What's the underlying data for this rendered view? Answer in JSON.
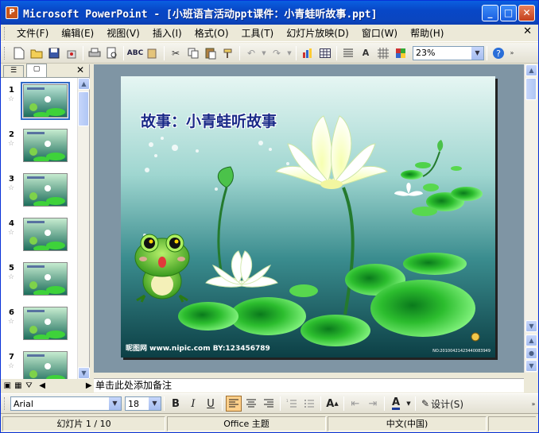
{
  "window": {
    "title": "Microsoft PowerPoint - [小班语言活动ppt课件：小青蛙听故事.ppt]"
  },
  "menu": {
    "items": [
      "文件(F)",
      "编辑(E)",
      "视图(V)",
      "插入(I)",
      "格式(O)",
      "工具(T)",
      "幻灯片放映(D)",
      "窗口(W)",
      "帮助(H)"
    ]
  },
  "toolbar": {
    "zoom": "23%"
  },
  "panel": {
    "tabs": [
      "outline-tab",
      "slides-tab"
    ]
  },
  "thumbnails": [
    {
      "num": "1",
      "selected": true,
      "bg": "#bde6d8"
    },
    {
      "num": "2",
      "selected": false,
      "bg": "#c7ecd0"
    },
    {
      "num": "3",
      "selected": false,
      "bg": "#c7ecd0"
    },
    {
      "num": "4",
      "selected": false,
      "bg": "#c7ecd0"
    },
    {
      "num": "5",
      "selected": false,
      "bg": "#c7ecd0"
    },
    {
      "num": "6",
      "selected": false,
      "bg": "#c7ecd0"
    },
    {
      "num": "7",
      "selected": false,
      "bg": "#c7ecd0"
    }
  ],
  "slide": {
    "title": "故事：小青蛙听故事",
    "watermark_left": "昵图网 www.nipic.com   BY:123456789",
    "watermark_right": "NO:20100421423440083949"
  },
  "notes": {
    "placeholder": "单击此处添加备注"
  },
  "format": {
    "font": "Arial",
    "size": "18",
    "design": "设计(S)"
  },
  "status": {
    "slide": "幻灯片 1 / 10",
    "theme": "Office 主题",
    "language": "中文(中国)"
  },
  "colors": {
    "titlebar": "#0a46c0",
    "slide_bg_top": "#d9f1ee",
    "slide_bg_bottom": "#0e4a4e",
    "pad_green": "#3ed23a"
  }
}
